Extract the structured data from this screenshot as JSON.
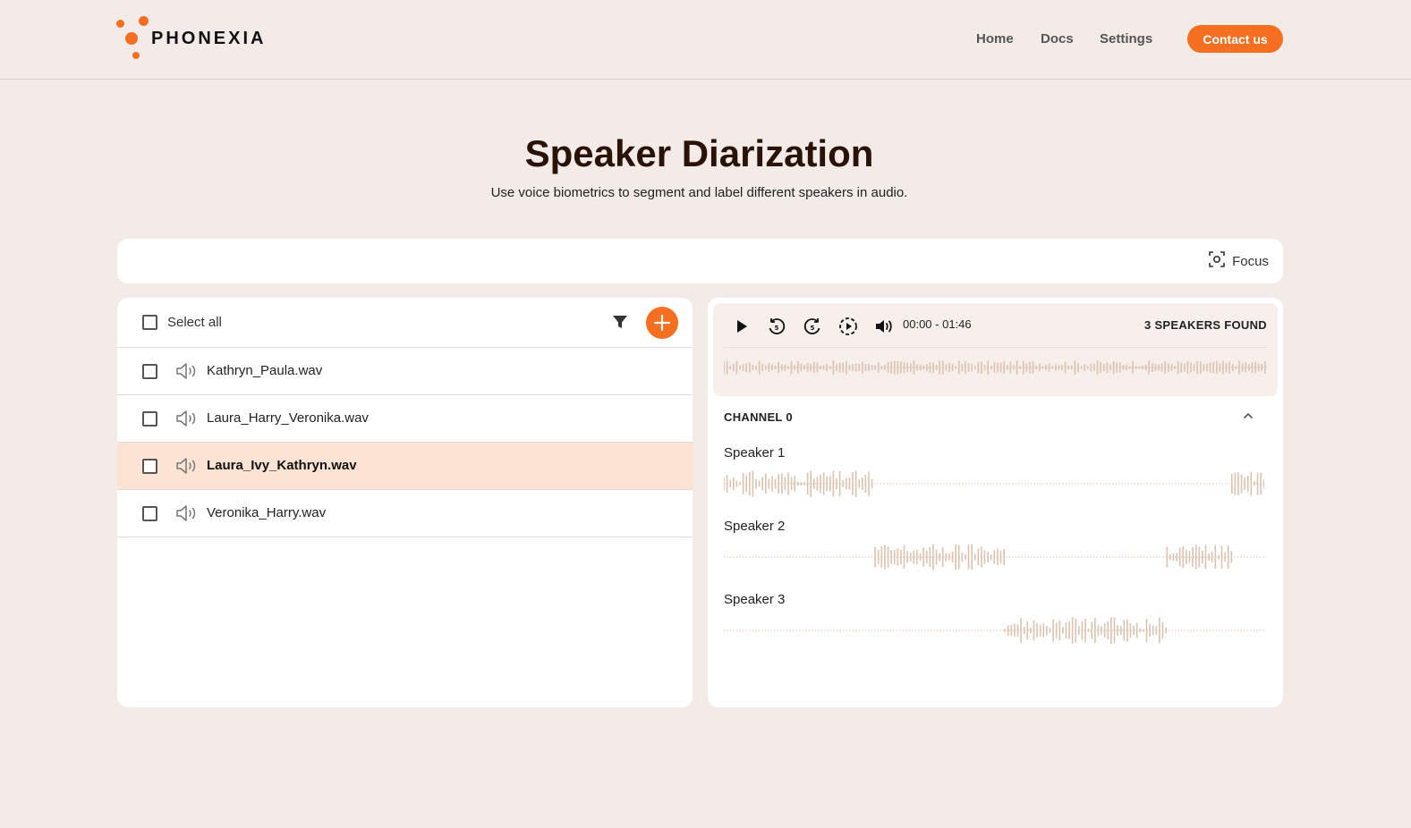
{
  "brand": {
    "name": "PHONEXIA",
    "accent": "#f46f1f"
  },
  "nav": {
    "home": "Home",
    "docs": "Docs",
    "settings": "Settings",
    "contact": "Contact us"
  },
  "hero": {
    "title": "Speaker Diarization",
    "subtitle": "Use voice biometrics to segment and label different speakers in audio."
  },
  "focus": {
    "label": "Focus",
    "icon": "focus-icon"
  },
  "files": {
    "select_all": "Select all",
    "items": [
      {
        "name": "Kathryn_Paula.wav",
        "selected": false
      },
      {
        "name": "Laura_Harry_Veronika.wav",
        "selected": false
      },
      {
        "name": "Laura_Ivy_Kathryn.wav",
        "selected": true
      },
      {
        "name": "Veronika_Harry.wav",
        "selected": false
      }
    ]
  },
  "player": {
    "time": "00:00 - 01:46",
    "speakers_found": "3 SPEAKERS FOUND",
    "channel": "CHANNEL 0",
    "speakers": [
      {
        "name": "Speaker 1",
        "segments": [
          [
            0.0,
            0.28
          ],
          [
            0.94,
            1.0
          ]
        ]
      },
      {
        "name": "Speaker 2",
        "segments": [
          [
            0.28,
            0.52
          ],
          [
            0.82,
            0.94
          ]
        ]
      },
      {
        "name": "Speaker 3",
        "segments": [
          [
            0.52,
            0.82
          ]
        ]
      }
    ],
    "wave_color": "#dcc2b0"
  }
}
